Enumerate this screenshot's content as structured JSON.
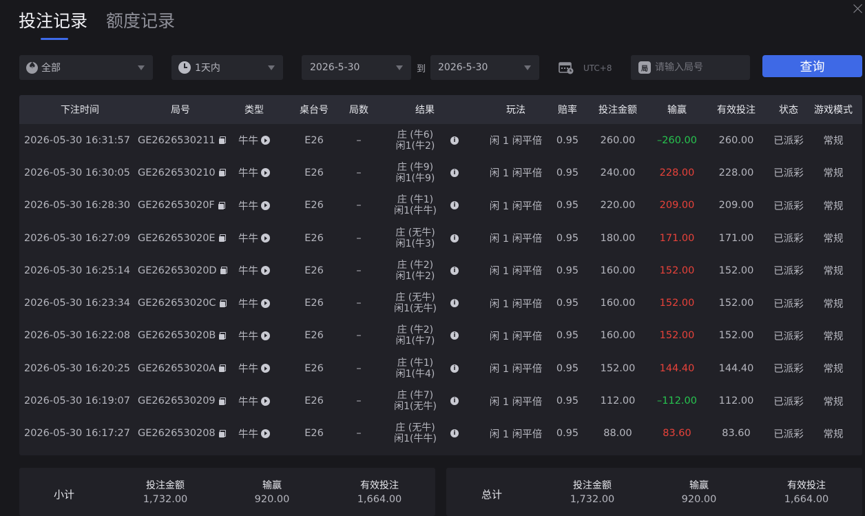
{
  "tabs": {
    "bet_records": "投注记录",
    "limit_records": "额度记录"
  },
  "filters": {
    "game": "全部",
    "period": "1天内",
    "date_from": "2026-5-30",
    "to_label": "到",
    "date_to": "2026-5-30",
    "timezone": "UTC+8",
    "round_placeholder": "请输入局号",
    "round_icon_char": "局",
    "query_label": "查询"
  },
  "columns": [
    "下注时间",
    "局号",
    "类型",
    "桌台号",
    "局数",
    "结果",
    "玩法",
    "赔率",
    "投注金额",
    "输赢",
    "有效投注",
    "状态",
    "游戏模式"
  ],
  "rows": [
    {
      "time": "2026-05-30 16:31:57",
      "round": "GE2626530211",
      "type": "牛牛",
      "table": "E26",
      "shoe": "–",
      "r1": "庄 (牛6)",
      "r2": "闲1(牛2)",
      "play": "闲 1 闲平倍",
      "odds": "0.95",
      "bet": "260.00",
      "winloss": "–260.00",
      "wl": "lose",
      "valid": "260.00",
      "status": "已派彩",
      "mode": "常规"
    },
    {
      "time": "2026-05-30 16:30:05",
      "round": "GE2626530210",
      "type": "牛牛",
      "table": "E26",
      "shoe": "–",
      "r1": "庄 (牛9)",
      "r2": "闲1(牛9)",
      "play": "闲 1 闲平倍",
      "odds": "0.95",
      "bet": "240.00",
      "winloss": "228.00",
      "wl": "win",
      "valid": "228.00",
      "status": "已派彩",
      "mode": "常规"
    },
    {
      "time": "2026-05-30 16:28:30",
      "round": "GE262653020F",
      "type": "牛牛",
      "table": "E26",
      "shoe": "–",
      "r1": "庄 (牛1)",
      "r2": "闲1(牛牛)",
      "play": "闲 1 闲平倍",
      "odds": "0.95",
      "bet": "220.00",
      "winloss": "209.00",
      "wl": "win",
      "valid": "209.00",
      "status": "已派彩",
      "mode": "常规"
    },
    {
      "time": "2026-05-30 16:27:09",
      "round": "GE262653020E",
      "type": "牛牛",
      "table": "E26",
      "shoe": "–",
      "r1": "庄 (无牛)",
      "r2": "闲1(牛3)",
      "play": "闲 1 闲平倍",
      "odds": "0.95",
      "bet": "180.00",
      "winloss": "171.00",
      "wl": "win",
      "valid": "171.00",
      "status": "已派彩",
      "mode": "常规"
    },
    {
      "time": "2026-05-30 16:25:14",
      "round": "GE262653020D",
      "type": "牛牛",
      "table": "E26",
      "shoe": "–",
      "r1": "庄 (牛2)",
      "r2": "闲1(牛2)",
      "play": "闲 1 闲平倍",
      "odds": "0.95",
      "bet": "160.00",
      "winloss": "152.00",
      "wl": "win",
      "valid": "152.00",
      "status": "已派彩",
      "mode": "常规"
    },
    {
      "time": "2026-05-30 16:23:34",
      "round": "GE262653020C",
      "type": "牛牛",
      "table": "E26",
      "shoe": "–",
      "r1": "庄 (无牛)",
      "r2": "闲1(无牛)",
      "play": "闲 1 闲平倍",
      "odds": "0.95",
      "bet": "160.00",
      "winloss": "152.00",
      "wl": "win",
      "valid": "152.00",
      "status": "已派彩",
      "mode": "常规"
    },
    {
      "time": "2026-05-30 16:22:08",
      "round": "GE262653020B",
      "type": "牛牛",
      "table": "E26",
      "shoe": "–",
      "r1": "庄 (牛2)",
      "r2": "闲1(牛7)",
      "play": "闲 1 闲平倍",
      "odds": "0.95",
      "bet": "160.00",
      "winloss": "152.00",
      "wl": "win",
      "valid": "152.00",
      "status": "已派彩",
      "mode": "常规"
    },
    {
      "time": "2026-05-30 16:20:25",
      "round": "GE262653020A",
      "type": "牛牛",
      "table": "E26",
      "shoe": "–",
      "r1": "庄 (牛1)",
      "r2": "闲1(牛4)",
      "play": "闲 1 闲平倍",
      "odds": "0.95",
      "bet": "152.00",
      "winloss": "144.40",
      "wl": "win",
      "valid": "144.40",
      "status": "已派彩",
      "mode": "常规"
    },
    {
      "time": "2026-05-30 16:19:07",
      "round": "GE2626530209",
      "type": "牛牛",
      "table": "E26",
      "shoe": "–",
      "r1": "庄 (牛7)",
      "r2": "闲1(无牛)",
      "play": "闲 1 闲平倍",
      "odds": "0.95",
      "bet": "112.00",
      "winloss": "–112.00",
      "wl": "lose",
      "valid": "112.00",
      "status": "已派彩",
      "mode": "常规"
    },
    {
      "time": "2026-05-30 16:17:27",
      "round": "GE2626530208",
      "type": "牛牛",
      "table": "E26",
      "shoe": "–",
      "r1": "庄 (无牛)",
      "r2": "闲1(牛牛)",
      "play": "闲 1 闲平倍",
      "odds": "0.95",
      "bet": "88.00",
      "winloss": "83.60",
      "wl": "win",
      "valid": "83.60",
      "status": "已派彩",
      "mode": "常规"
    }
  ],
  "subtotal": {
    "label": "小计",
    "bet_label": "投注金额",
    "bet": "1,732.00",
    "wl_label": "输赢",
    "wl": "920.00",
    "valid_label": "有效投注",
    "valid": "1,664.00"
  },
  "total": {
    "label": "总计",
    "bet_label": "投注金额",
    "bet": "1,732.00",
    "wl_label": "输赢",
    "wl": "920.00",
    "valid_label": "有效投注",
    "valid": "1,664.00"
  },
  "colors": {
    "accent": "#3e69e6",
    "win": "#e8423a",
    "lose": "#27c44f",
    "background": "#18181c"
  },
  "icons": [
    "close-icon",
    "spade-icon",
    "clock-icon",
    "calendar-icon",
    "round-icon",
    "copy-icon",
    "play-icon",
    "info-icon",
    "caret-down-icon"
  ]
}
